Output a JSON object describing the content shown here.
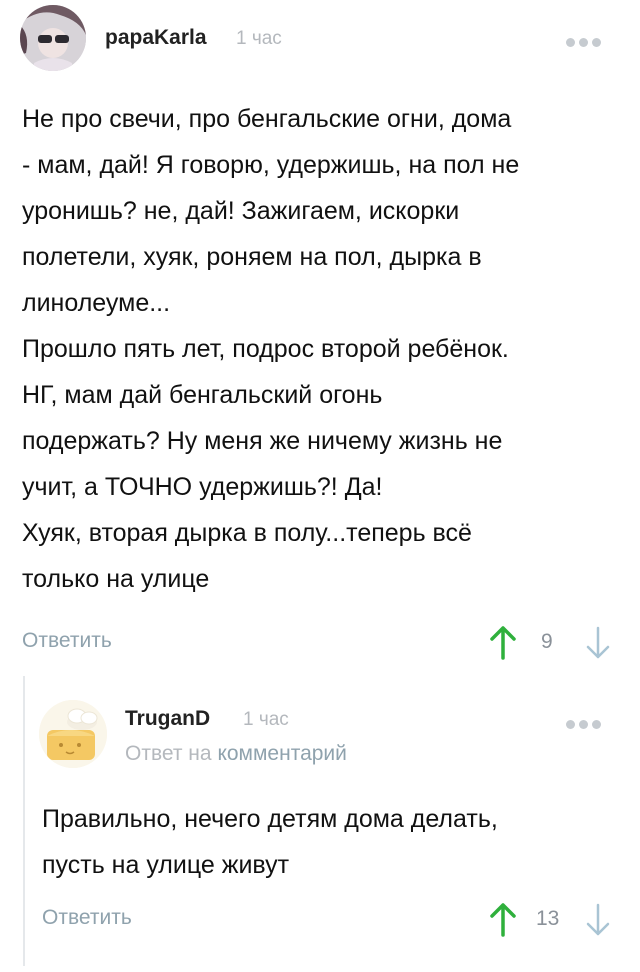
{
  "colors": {
    "upvote": "#2fb03c",
    "downvote": "#a9c4d4",
    "muted": "#b4b8bd",
    "link": "#8fa2ad"
  },
  "comment": {
    "author": "papaKarla",
    "time": "1 час",
    "lines": [
      "Не про свечи, про бенгальские огни, дома",
      "- мам, дай! Я говорю, удержишь, на пол не",
      "уронишь? не, дай! Зажигаем, искорки",
      "полетели, хуяк, роняем  на пол, дырка в",
      "линолеуме...",
      "Прошло пять лет, подрос второй ребёнок.",
      "НГ, мам дай бенгальский огонь",
      "подержать? Ну меня же ничему жизнь не",
      "учит, а ТОЧНО удержишь?! Да!",
      "Хуяк, вторая дырка в полу...теперь всё",
      "только на улице"
    ],
    "reply_label": "Ответить",
    "rating": "9",
    "icons": {
      "more": "more-dots-icon",
      "up": "arrow-up-icon",
      "down": "arrow-down-icon"
    }
  },
  "reply": {
    "author": "TruganD",
    "time": "1 час",
    "reply_to_prefix": "Ответ на",
    "reply_to_link": "комментарий",
    "lines": [
      "Правильно, нечего детям дома делать,",
      "пусть на улице живут"
    ],
    "reply_label": "Ответить",
    "rating": "13",
    "icons": {
      "more": "more-dots-icon",
      "up": "arrow-up-icon",
      "down": "arrow-down-icon"
    }
  }
}
